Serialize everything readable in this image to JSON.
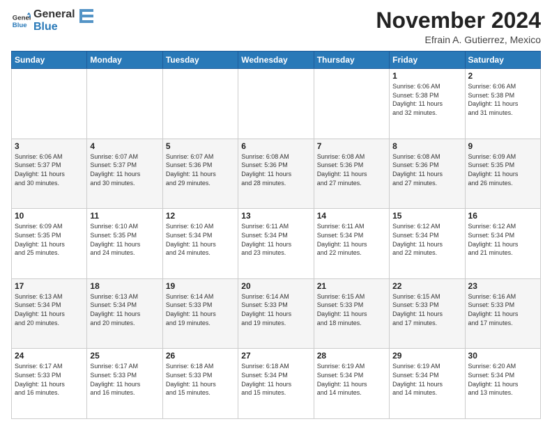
{
  "logo": {
    "line1": "General",
    "line2": "Blue"
  },
  "title": "November 2024",
  "subtitle": "Efrain A. Gutierrez, Mexico",
  "days_header": [
    "Sunday",
    "Monday",
    "Tuesday",
    "Wednesday",
    "Thursday",
    "Friday",
    "Saturday"
  ],
  "weeks": [
    [
      {
        "day": "",
        "info": ""
      },
      {
        "day": "",
        "info": ""
      },
      {
        "day": "",
        "info": ""
      },
      {
        "day": "",
        "info": ""
      },
      {
        "day": "",
        "info": ""
      },
      {
        "day": "1",
        "info": "Sunrise: 6:06 AM\nSunset: 5:38 PM\nDaylight: 11 hours\nand 32 minutes."
      },
      {
        "day": "2",
        "info": "Sunrise: 6:06 AM\nSunset: 5:38 PM\nDaylight: 11 hours\nand 31 minutes."
      }
    ],
    [
      {
        "day": "3",
        "info": "Sunrise: 6:06 AM\nSunset: 5:37 PM\nDaylight: 11 hours\nand 30 minutes."
      },
      {
        "day": "4",
        "info": "Sunrise: 6:07 AM\nSunset: 5:37 PM\nDaylight: 11 hours\nand 30 minutes."
      },
      {
        "day": "5",
        "info": "Sunrise: 6:07 AM\nSunset: 5:36 PM\nDaylight: 11 hours\nand 29 minutes."
      },
      {
        "day": "6",
        "info": "Sunrise: 6:08 AM\nSunset: 5:36 PM\nDaylight: 11 hours\nand 28 minutes."
      },
      {
        "day": "7",
        "info": "Sunrise: 6:08 AM\nSunset: 5:36 PM\nDaylight: 11 hours\nand 27 minutes."
      },
      {
        "day": "8",
        "info": "Sunrise: 6:08 AM\nSunset: 5:36 PM\nDaylight: 11 hours\nand 27 minutes."
      },
      {
        "day": "9",
        "info": "Sunrise: 6:09 AM\nSunset: 5:35 PM\nDaylight: 11 hours\nand 26 minutes."
      }
    ],
    [
      {
        "day": "10",
        "info": "Sunrise: 6:09 AM\nSunset: 5:35 PM\nDaylight: 11 hours\nand 25 minutes."
      },
      {
        "day": "11",
        "info": "Sunrise: 6:10 AM\nSunset: 5:35 PM\nDaylight: 11 hours\nand 24 minutes."
      },
      {
        "day": "12",
        "info": "Sunrise: 6:10 AM\nSunset: 5:34 PM\nDaylight: 11 hours\nand 24 minutes."
      },
      {
        "day": "13",
        "info": "Sunrise: 6:11 AM\nSunset: 5:34 PM\nDaylight: 11 hours\nand 23 minutes."
      },
      {
        "day": "14",
        "info": "Sunrise: 6:11 AM\nSunset: 5:34 PM\nDaylight: 11 hours\nand 22 minutes."
      },
      {
        "day": "15",
        "info": "Sunrise: 6:12 AM\nSunset: 5:34 PM\nDaylight: 11 hours\nand 22 minutes."
      },
      {
        "day": "16",
        "info": "Sunrise: 6:12 AM\nSunset: 5:34 PM\nDaylight: 11 hours\nand 21 minutes."
      }
    ],
    [
      {
        "day": "17",
        "info": "Sunrise: 6:13 AM\nSunset: 5:34 PM\nDaylight: 11 hours\nand 20 minutes."
      },
      {
        "day": "18",
        "info": "Sunrise: 6:13 AM\nSunset: 5:34 PM\nDaylight: 11 hours\nand 20 minutes."
      },
      {
        "day": "19",
        "info": "Sunrise: 6:14 AM\nSunset: 5:33 PM\nDaylight: 11 hours\nand 19 minutes."
      },
      {
        "day": "20",
        "info": "Sunrise: 6:14 AM\nSunset: 5:33 PM\nDaylight: 11 hours\nand 19 minutes."
      },
      {
        "day": "21",
        "info": "Sunrise: 6:15 AM\nSunset: 5:33 PM\nDaylight: 11 hours\nand 18 minutes."
      },
      {
        "day": "22",
        "info": "Sunrise: 6:15 AM\nSunset: 5:33 PM\nDaylight: 11 hours\nand 17 minutes."
      },
      {
        "day": "23",
        "info": "Sunrise: 6:16 AM\nSunset: 5:33 PM\nDaylight: 11 hours\nand 17 minutes."
      }
    ],
    [
      {
        "day": "24",
        "info": "Sunrise: 6:17 AM\nSunset: 5:33 PM\nDaylight: 11 hours\nand 16 minutes."
      },
      {
        "day": "25",
        "info": "Sunrise: 6:17 AM\nSunset: 5:33 PM\nDaylight: 11 hours\nand 16 minutes."
      },
      {
        "day": "26",
        "info": "Sunrise: 6:18 AM\nSunset: 5:33 PM\nDaylight: 11 hours\nand 15 minutes."
      },
      {
        "day": "27",
        "info": "Sunrise: 6:18 AM\nSunset: 5:34 PM\nDaylight: 11 hours\nand 15 minutes."
      },
      {
        "day": "28",
        "info": "Sunrise: 6:19 AM\nSunset: 5:34 PM\nDaylight: 11 hours\nand 14 minutes."
      },
      {
        "day": "29",
        "info": "Sunrise: 6:19 AM\nSunset: 5:34 PM\nDaylight: 11 hours\nand 14 minutes."
      },
      {
        "day": "30",
        "info": "Sunrise: 6:20 AM\nSunset: 5:34 PM\nDaylight: 11 hours\nand 13 minutes."
      }
    ]
  ]
}
